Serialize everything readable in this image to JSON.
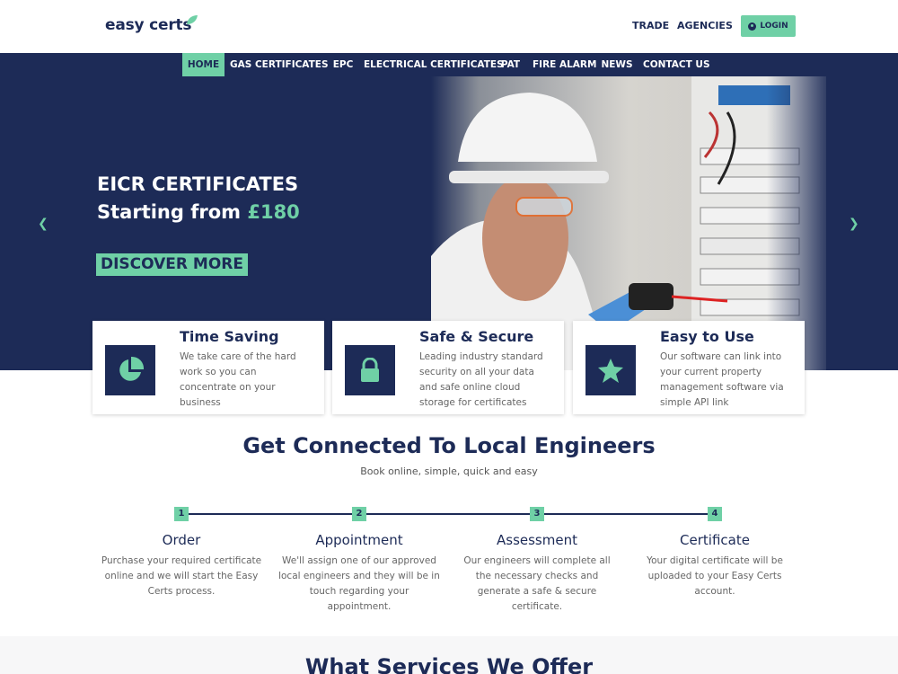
{
  "header": {
    "logo_text": "easy certs",
    "links": [
      "TRADE",
      "AGENCIES"
    ],
    "login_label": "LOGIN"
  },
  "nav": {
    "items": [
      {
        "label": "HOME",
        "active": true
      },
      {
        "label": "GAS CERTIFICATES"
      },
      {
        "label": "EPC"
      },
      {
        "label": "ELECTRICAL CERTIFICATES"
      },
      {
        "label": "PAT"
      },
      {
        "label": "FIRE ALARM"
      },
      {
        "label": "NEWS"
      },
      {
        "label": "CONTACT US"
      }
    ]
  },
  "hero": {
    "title_line1": "EICR CERTIFICATES",
    "title_line2_prefix": "Starting from ",
    "title_line2_price": "£180",
    "cta_label": "DISCOVER MORE",
    "prev_icon": "chevron-left-icon",
    "next_icon": "chevron-right-icon"
  },
  "features": [
    {
      "title": "Time Saving",
      "text": "We take care of the hard work so you can concentrate on your business",
      "icon": "pie-chart-icon"
    },
    {
      "title": "Safe & Secure",
      "text": "Leading industry standard security on all your data and safe online cloud storage for certificates",
      "icon": "lock-icon"
    },
    {
      "title": "Easy to Use",
      "text": "Our software can link into your current property management software via simple API link",
      "icon": "star-icon"
    }
  ],
  "connect": {
    "title": "Get Connected To Local Engineers",
    "subtitle": "Book online, simple, quick and easy",
    "steps": [
      {
        "num": "1",
        "title": "Order",
        "text": "Purchase your required certificate online and we will start the Easy Certs process."
      },
      {
        "num": "2",
        "title": "Appointment",
        "text": "We'll assign one of our approved local engineers and they will be in touch regarding your appointment."
      },
      {
        "num": "3",
        "title": "Assessment",
        "text": "Our engineers will complete all the necessary checks and generate a safe & secure certificate."
      },
      {
        "num": "4",
        "title": "Certificate",
        "text": "Your digital certificate will be uploaded to your Easy Certs account."
      }
    ]
  },
  "services": {
    "title": "What Services We Offer"
  },
  "colors": {
    "navy": "#1d2b57",
    "mint": "#6fd0a6"
  }
}
